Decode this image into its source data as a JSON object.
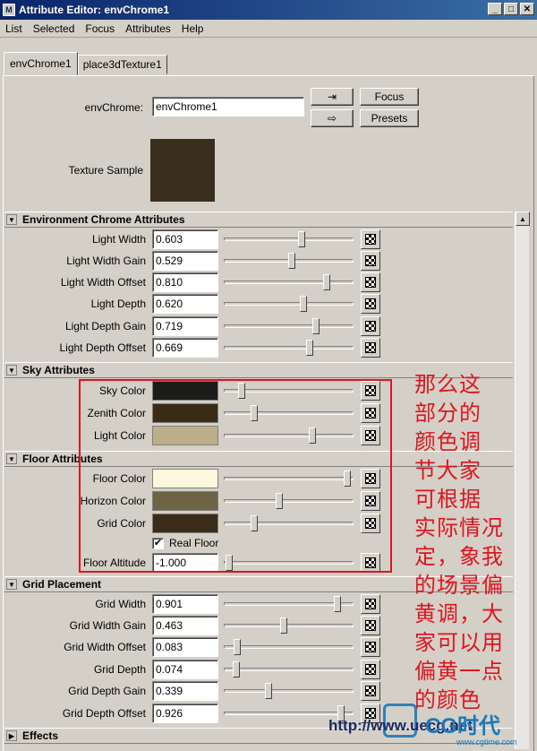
{
  "window": {
    "title": "Attribute Editor: envChrome1"
  },
  "menu": [
    "List",
    "Selected",
    "Focus",
    "Attributes",
    "Help"
  ],
  "tabs": [
    "envChrome1",
    "place3dTexture1"
  ],
  "node": {
    "label": "envChrome:",
    "value": "envChrome1",
    "focus_label": "Focus",
    "presets_label": "Presets",
    "texture_label": "Texture Sample",
    "texture_color": "#3a2e1e"
  },
  "sections": {
    "env": "Environment Chrome Attributes",
    "sky": "Sky Attributes",
    "floor": "Floor Attributes",
    "grid": "Grid Placement",
    "effects": "Effects"
  },
  "env_attrs": [
    {
      "label": "Light Width",
      "value": "0.603",
      "level": 0.603
    },
    {
      "label": "Light Width Gain",
      "value": "0.529",
      "level": 0.529
    },
    {
      "label": "Light Width Offset",
      "value": "0.810",
      "level": 0.81
    },
    {
      "label": "Light Depth",
      "value": "0.620",
      "level": 0.62
    },
    {
      "label": "Light Depth Gain",
      "value": "0.719",
      "level": 0.719
    },
    {
      "label": "Light Depth Offset",
      "value": "0.669",
      "level": 0.669
    }
  ],
  "sky_attrs": [
    {
      "label": "Sky Color",
      "color": "#1c1c1a",
      "level": 0.12
    },
    {
      "label": "Zenith Color",
      "color": "#3a2a16",
      "level": 0.22
    },
    {
      "label": "Light Color",
      "color": "#bcae88",
      "level": 0.69
    }
  ],
  "floor_attrs": [
    {
      "label": "Floor Color",
      "color": "#fcf8de",
      "level": 0.98
    },
    {
      "label": "Horizon Color",
      "color": "#6c6444",
      "level": 0.42
    },
    {
      "label": "Grid Color",
      "color": "#3a2c18",
      "level": 0.22
    }
  ],
  "real_floor": {
    "label": "Real Floor",
    "checked": "✔"
  },
  "floor_altitude": {
    "label": "Floor Altitude",
    "value": "-1.000",
    "level": 0.0
  },
  "grid_attrs": [
    {
      "label": "Grid Width",
      "value": "0.901",
      "level": 0.901
    },
    {
      "label": "Grid Width Gain",
      "value": "0.463",
      "level": 0.463
    },
    {
      "label": "Grid Width Offset",
      "value": "0.083",
      "level": 0.083
    },
    {
      "label": "Grid Depth",
      "value": "0.074",
      "level": 0.074
    },
    {
      "label": "Grid Depth Gain",
      "value": "0.339",
      "level": 0.339
    },
    {
      "label": "Grid Depth Offset",
      "value": "0.926",
      "level": 0.926
    }
  ],
  "annotation": [
    "那么这",
    "部分的",
    "颜色调",
    "节大家",
    "可根据",
    "实际情况",
    "定，象我",
    "的场景偏",
    "黄调，大",
    "家可以用",
    "偏黄一点",
    "的颜色"
  ],
  "watermark": {
    "url": "http://www.uecg.net",
    "brand": "CG时代",
    "small": "www.cgtime.com"
  }
}
